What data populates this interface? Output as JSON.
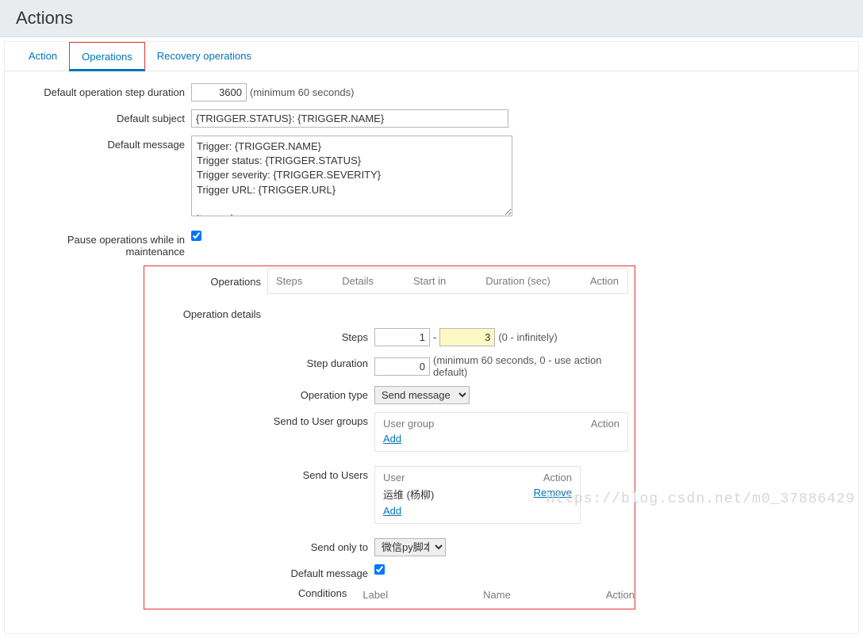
{
  "page_title": "Actions",
  "tabs": {
    "action": "Action",
    "operations": "Operations",
    "recovery": "Recovery operations"
  },
  "labels": {
    "step_duration": "Default operation step duration",
    "default_subject": "Default subject",
    "default_message": "Default message",
    "pause_maintenance": "Pause operations while in maintenance",
    "operations": "Operations",
    "operation_details": "Operation details",
    "steps": "Steps",
    "step_duration2": "Step duration",
    "operation_type": "Operation type",
    "send_to_user_groups": "Send to User groups",
    "send_to_users": "Send to Users",
    "send_only_to": "Send only to",
    "default_message2": "Default message",
    "conditions": "Conditions"
  },
  "values": {
    "step_duration": "3600",
    "default_subject": "{TRIGGER.STATUS}: {TRIGGER.NAME}",
    "default_message": "Trigger: {TRIGGER.NAME}\nTrigger status: {TRIGGER.STATUS}\nTrigger severity: {TRIGGER.SEVERITY}\nTrigger URL: {TRIGGER.URL}\n\nItem values:\n",
    "pause_checked": true,
    "step_from": "1",
    "step_to": "3",
    "step_duration2": "0",
    "operation_type": "Send message",
    "send_only_to": "微信py脚本",
    "default_message2_checked": true,
    "user_row": "运维 (杨柳)"
  },
  "hints": {
    "min60": "(minimum 60 seconds)",
    "infinitely": "(0 - infinitely)",
    "min60_default": "(minimum 60 seconds, 0 - use action default)"
  },
  "ops_table": {
    "steps": "Steps",
    "details": "Details",
    "start_in": "Start in",
    "duration": "Duration (sec)",
    "action": "Action"
  },
  "inner": {
    "user_group": "User group",
    "user": "User",
    "action": "Action",
    "add": "Add",
    "remove": "Remove"
  },
  "cond": {
    "label": "Label",
    "name": "Name",
    "action": "Action"
  },
  "watermark": "https://blog.csdn.net/m0_37886429"
}
